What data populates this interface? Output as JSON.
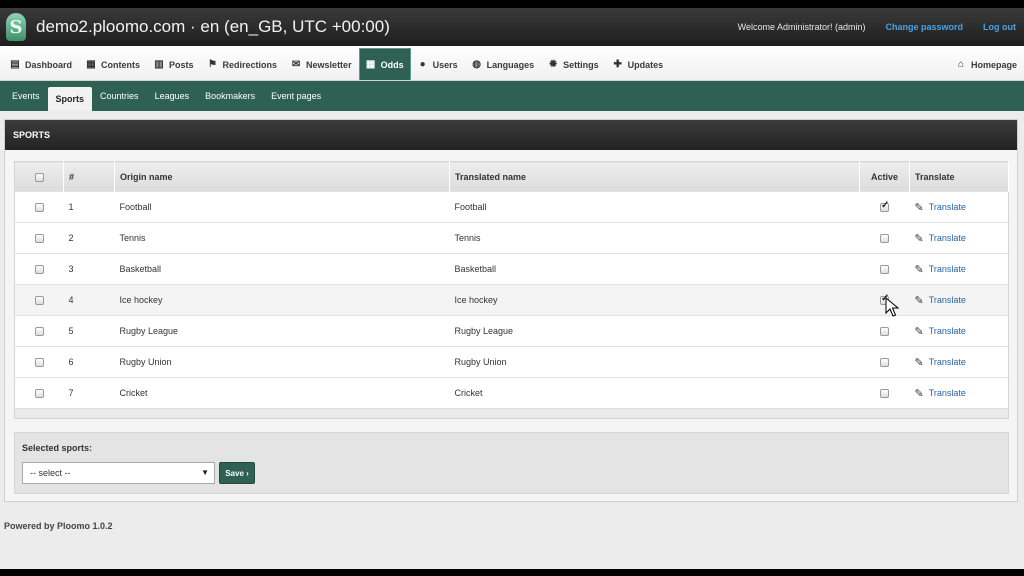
{
  "header": {
    "title": "demo2.ploomo.com · en (en_GB, UTC +00:00)",
    "logo_letter": "S",
    "welcome": "Welcome Administrator! (admin)",
    "change_password": "Change password",
    "logout": "Log out"
  },
  "main_menu": {
    "items": [
      {
        "label": "Dashboard",
        "icon": "dashboard-icon"
      },
      {
        "label": "Contents",
        "icon": "document-icon"
      },
      {
        "label": "Posts",
        "icon": "calendar-icon"
      },
      {
        "label": "Redirections",
        "icon": "signpost-icon"
      },
      {
        "label": "Newsletter",
        "icon": "envelope-icon"
      },
      {
        "label": "Odds",
        "icon": "table-icon",
        "active": true
      },
      {
        "label": "Users",
        "icon": "user-icon"
      },
      {
        "label": "Languages",
        "icon": "globe-icon"
      },
      {
        "label": "Settings",
        "icon": "gear-icon"
      },
      {
        "label": "Updates",
        "icon": "puzzle-icon"
      }
    ],
    "homepage": "Homepage"
  },
  "sub_menu": {
    "items": [
      "Events",
      "Sports",
      "Countries",
      "Leagues",
      "Bookmakers",
      "Event pages"
    ],
    "active": "Sports"
  },
  "panel": {
    "title": "SPORTS",
    "columns": {
      "num": "#",
      "origin": "Origin name",
      "translated": "Translated name",
      "active": "Active",
      "translate": "Translate"
    },
    "rows": [
      {
        "num": "1",
        "origin": "Football",
        "translated": "Football",
        "active": true,
        "action": "Translate"
      },
      {
        "num": "2",
        "origin": "Tennis",
        "translated": "Tennis",
        "active": false,
        "action": "Translate"
      },
      {
        "num": "3",
        "origin": "Basketball",
        "translated": "Basketball",
        "active": false,
        "action": "Translate"
      },
      {
        "num": "4",
        "origin": "Ice hockey",
        "translated": "Ice hockey",
        "active": true,
        "action": "Translate"
      },
      {
        "num": "5",
        "origin": "Rugby League",
        "translated": "Rugby League",
        "active": false,
        "action": "Translate"
      },
      {
        "num": "6",
        "origin": "Rugby Union",
        "translated": "Rugby Union",
        "active": false,
        "action": "Translate"
      },
      {
        "num": "7",
        "origin": "Cricket",
        "translated": "Cricket",
        "active": false,
        "action": "Translate"
      }
    ],
    "bulk": {
      "label": "Selected sports:",
      "select_value": "-- select --",
      "save": "Save ›"
    }
  },
  "footer": "Powered by Ploomo 1.0.2",
  "colors": {
    "brand_green": "#2e6151",
    "link_blue": "#2a62a8",
    "top_link_blue": "#45a3e6"
  }
}
